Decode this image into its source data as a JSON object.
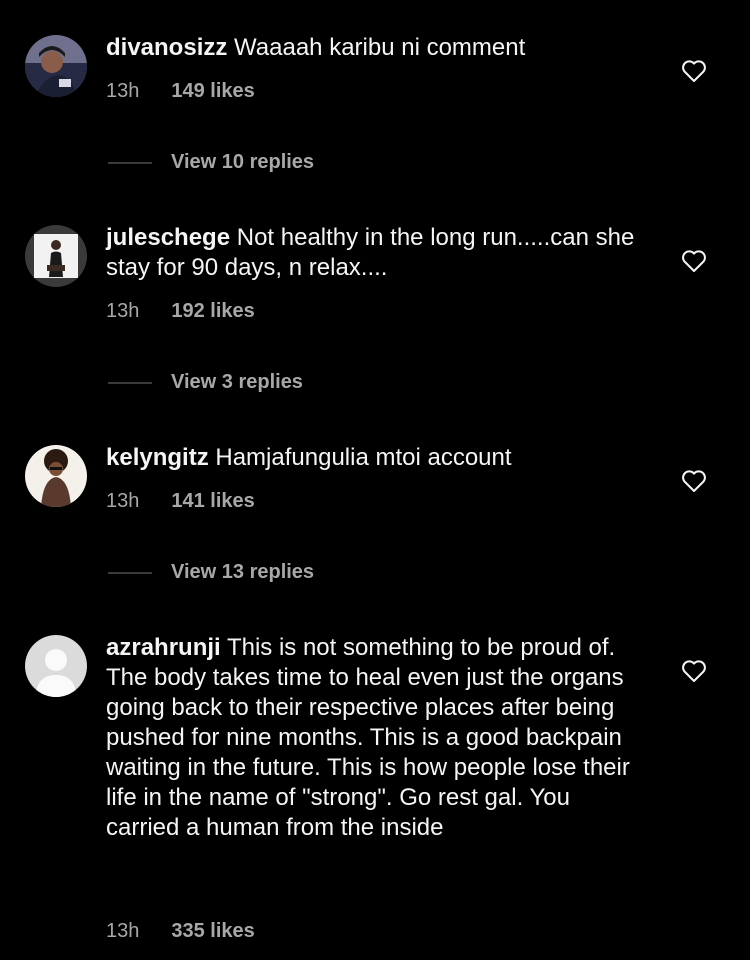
{
  "comments": [
    {
      "username": "divanosizz",
      "text": "Waaaah karibu ni comment",
      "time": "13h",
      "likes": "149 likes",
      "replies": "View 10 replies"
    },
    {
      "username": "juleschege",
      "text": "Not healthy in the long run.....can she stay for 90 days, n relax....",
      "time": "13h",
      "likes": "192 likes",
      "replies": "View 3 replies"
    },
    {
      "username": "kelyngitz",
      "text": "Hamjafungulia mtoi account",
      "time": "13h",
      "likes": "141 likes",
      "replies": "View 13 replies"
    },
    {
      "username": "azrahrunji",
      "text": "This is not something to be proud of. The body takes time to heal even just the organs going back to their respective places after being pushed for nine months. This is a good backpain waiting in the future. This is how people lose their life in the name of \"strong\". Go rest gal. You carried a human from the inside",
      "time": "13h",
      "likes": "335 likes"
    }
  ],
  "icons": {
    "like": "heart-outline-icon",
    "avatar_default": "default-avatar-icon"
  },
  "colors": {
    "background": "#000000",
    "text": "#f5f5f5",
    "muted": "#a8a8a8"
  }
}
